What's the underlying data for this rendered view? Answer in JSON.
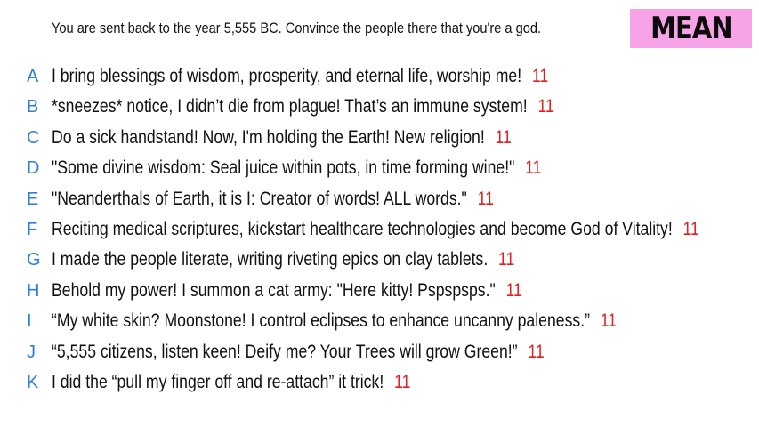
{
  "prompt": "You are sent back to the year 5,555 BC. Convince the people there that you're a god.",
  "badge": {
    "label": "MEAN",
    "background": "#f7a3e8"
  },
  "colors": {
    "letter": "#2f7fd6",
    "score": "#e02020",
    "text": "#111111"
  },
  "answers": [
    {
      "letter": "A",
      "text": "I bring blessings of wisdom, prosperity, and eternal life, worship me!",
      "score": "11"
    },
    {
      "letter": "B",
      "text": "*sneezes* notice, I didn’t die from plague! That’s an immune system!",
      "score": "11"
    },
    {
      "letter": "C",
      "text": "Do a sick handstand! Now, I'm holding the Earth! New religion!",
      "score": "11"
    },
    {
      "letter": "D",
      "text": "\"Some divine wisdom: Seal juice within pots, in time forming wine!\"",
      "score": "11"
    },
    {
      "letter": "E",
      "text": "\"Neanderthals of Earth, it is I: Creator of words! ALL words.\"",
      "score": "11"
    },
    {
      "letter": "F",
      "text": "Reciting medical scriptures, kickstart healthcare technologies and become God of Vitality!",
      "score": "11"
    },
    {
      "letter": "G",
      "text": "I made the people literate, writing riveting epics on clay tablets.",
      "score": "11"
    },
    {
      "letter": "H",
      "text": "Behold my power! I summon a cat army: \"Here kitty! Pspspsps.\"",
      "score": "11"
    },
    {
      "letter": "I",
      "text": "“My white skin? Moonstone! I control eclipses to enhance uncanny paleness.”",
      "score": "11"
    },
    {
      "letter": "J",
      "text": "“5,555 citizens, listen keen! Deify me? Your Trees will grow Green!”",
      "score": "11"
    },
    {
      "letter": "K",
      "text": "I did the “pull my finger off and re-attach” it trick!",
      "score": "11"
    }
  ]
}
